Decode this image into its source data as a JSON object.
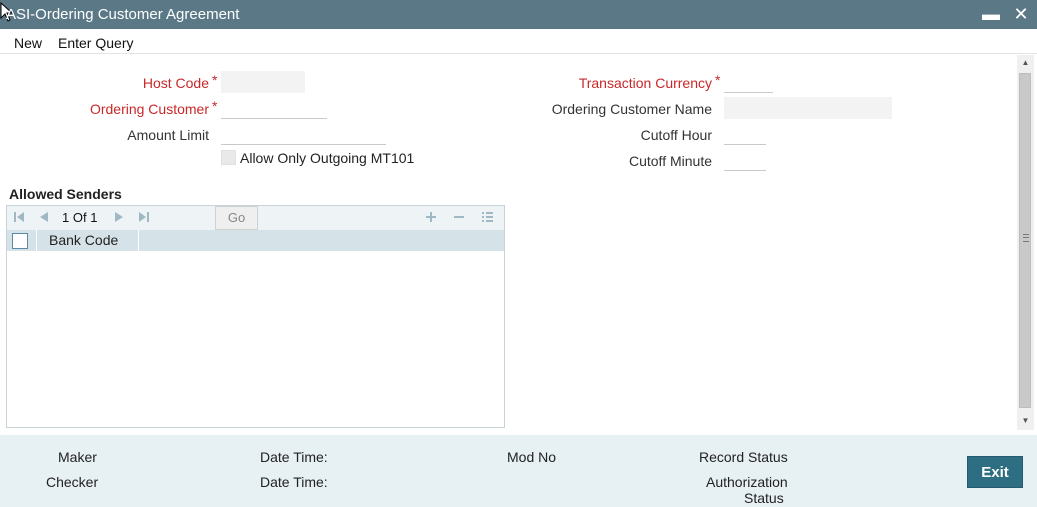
{
  "window": {
    "title": "ASI-Ordering Customer Agreement",
    "minimize_glyph": "▬",
    "close_glyph": "✕"
  },
  "menu": {
    "new_label": "New",
    "enter_query_label": "Enter Query"
  },
  "form": {
    "host_code": {
      "label": "Host Code",
      "required": "*",
      "value": ""
    },
    "ordering_customer": {
      "label": "Ordering Customer",
      "required": "*",
      "value": ""
    },
    "amount_limit": {
      "label": "Amount Limit",
      "value": ""
    },
    "allow_outgoing": {
      "label": "Allow Only Outgoing MT101",
      "checked": false
    },
    "transaction_currency": {
      "label": "Transaction Currency",
      "required": "*",
      "value": ""
    },
    "ordering_customer_name": {
      "label": "Ordering Customer Name",
      "value": ""
    },
    "cutoff_hour": {
      "label": "Cutoff Hour",
      "value": ""
    },
    "cutoff_minute": {
      "label": "Cutoff Minute",
      "value": ""
    }
  },
  "allowed_senders": {
    "title": "Allowed Senders",
    "pager": {
      "current": "1",
      "of_label": "Of",
      "total": "1"
    },
    "go_label": "Go",
    "columns": [
      "Bank Code"
    ],
    "rows": []
  },
  "footer": {
    "maker_label": "Maker",
    "checker_label": "Checker",
    "date_time_label_1": "Date Time:",
    "date_time_label_2": "Date Time:",
    "mod_no_label": "Mod No",
    "record_status_label": "Record Status",
    "authorization_label_line1": "Authorization",
    "authorization_label_line2": "Status",
    "exit_label": "Exit"
  },
  "colors": {
    "titlebar": "#5b7887",
    "required": "#c8282a",
    "footer": "#e7f0f2",
    "exit_button": "#2e6e83"
  }
}
